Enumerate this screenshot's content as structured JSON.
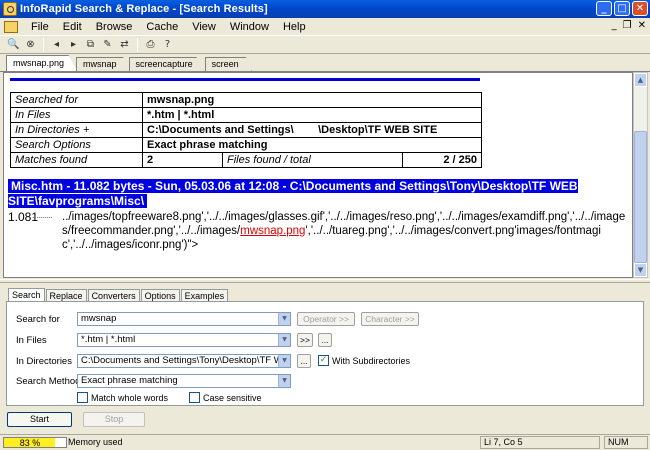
{
  "window": {
    "title": "InfoRapid Search & Replace - [Search Results]"
  },
  "menu": {
    "items": [
      "File",
      "Edit",
      "Browse",
      "Cache",
      "View",
      "Window",
      "Help"
    ]
  },
  "doc_tabs": [
    "mwsnap.png",
    "mwsnap",
    "screencapture",
    "screen"
  ],
  "summary": {
    "rows": [
      {
        "label": "Searched for",
        "value": "mwsnap.png"
      },
      {
        "label": "In Files",
        "value": "*.htm | *.html"
      },
      {
        "label": "In Directories +",
        "value": "C:\\Documents and Settings\\        \\Desktop\\TF WEB SITE"
      },
      {
        "label": "Search Options",
        "value": "Exact phrase matching"
      }
    ],
    "matches_label": "Matches found",
    "matches_value": "2",
    "files_label": "Files found / total",
    "files_value": "2 / 250"
  },
  "result": {
    "header": "Misc.htm  -  11.082 bytes  -  Sun, 05.03.06 at 12:08  -  C:\\Documents and Settings\\Tony\\Desktop\\TF WEB SITE\\favprograms\\Misc\\",
    "line_number": "1.081",
    "snippet_before": "../images/topfreeware8.png','../../images/glasses.gif','../../images/reso.png','../../images/examdiff.png','../../images/freecommander.png','../../images/",
    "snippet_match": "mwsnap.png",
    "snippet_after": "','../../tuareg.png','../../images/convert.png'images/fontmagic','../../images/iconr.png')\">"
  },
  "bottom_tabs": [
    "Search",
    "Replace",
    "Converters",
    "Options",
    "Examples"
  ],
  "form": {
    "search_for_label": "Search for",
    "search_for_value": "mwsnap",
    "in_files_label": "In Files",
    "in_files_value": "*.htm | *.html",
    "in_dirs_label": "In Directories",
    "in_dirs_value": "C:\\Documents and Settings\\Tony\\Desktop\\TF WEB SITE",
    "method_label": "Search Method",
    "method_value": "Exact phrase matching",
    "operator_label": "Operator >>",
    "character_label": "Character >>",
    "arrow_btn": ">>",
    "browse_btn": "...",
    "with_subdirs": "With Subdirectories",
    "whole_words": "Match whole words",
    "case_sensitive": "Case sensitive"
  },
  "actions": {
    "start": "Start",
    "stop": "Stop"
  },
  "status": {
    "memory_pct": "83 %",
    "memory_fraction": 0.83,
    "memory_label": "Memory used",
    "position": "Li 7, Co 5",
    "num": "NUM"
  }
}
